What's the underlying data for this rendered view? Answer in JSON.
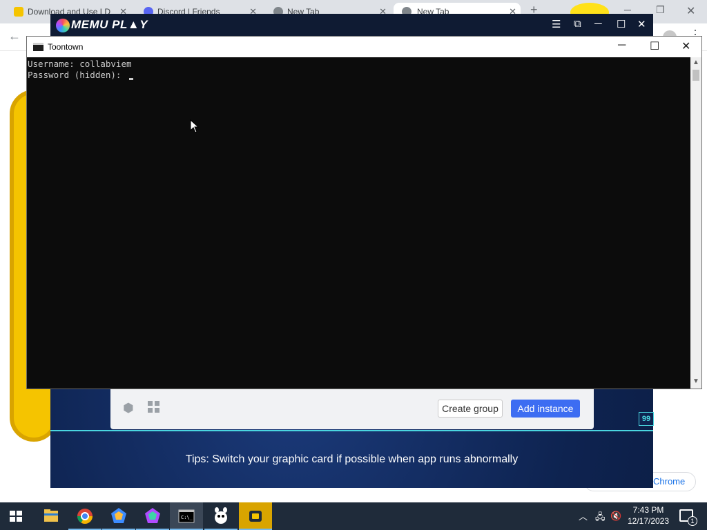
{
  "chrome": {
    "tabs": [
      {
        "title": "Download and Use LD",
        "icon": "ldplayer-icon"
      },
      {
        "title": "Discord | Friends",
        "icon": "discord-icon"
      },
      {
        "title": "New Tab",
        "icon": "chrome-icon"
      },
      {
        "title": "New Tab",
        "icon": "chrome-icon"
      }
    ],
    "new_tab_symbol": "+",
    "bottom_link_label": "Chrome"
  },
  "memu": {
    "logo_text": "MEMU PL▲Y",
    "create_group_label": "Create group",
    "add_instance_label": "Add instance",
    "fps_badge": "99",
    "tips": "Tips: Switch your graphic card if possible when app runs abnormally",
    "accent_color": "#3d6df2"
  },
  "console": {
    "title": "Toontown",
    "lines": [
      "Username: collabviem",
      "Password (hidden): "
    ]
  },
  "taskbar": {
    "apps": [
      "file-explorer-icon",
      "chrome-icon",
      "memu-multi-icon",
      "memu-icon",
      "command-prompt-icon",
      "toontown-launcher-icon",
      "ldplayer-icon"
    ],
    "clock_time": "7:43 PM",
    "clock_date": "12/17/2023",
    "notification_count": "1"
  }
}
